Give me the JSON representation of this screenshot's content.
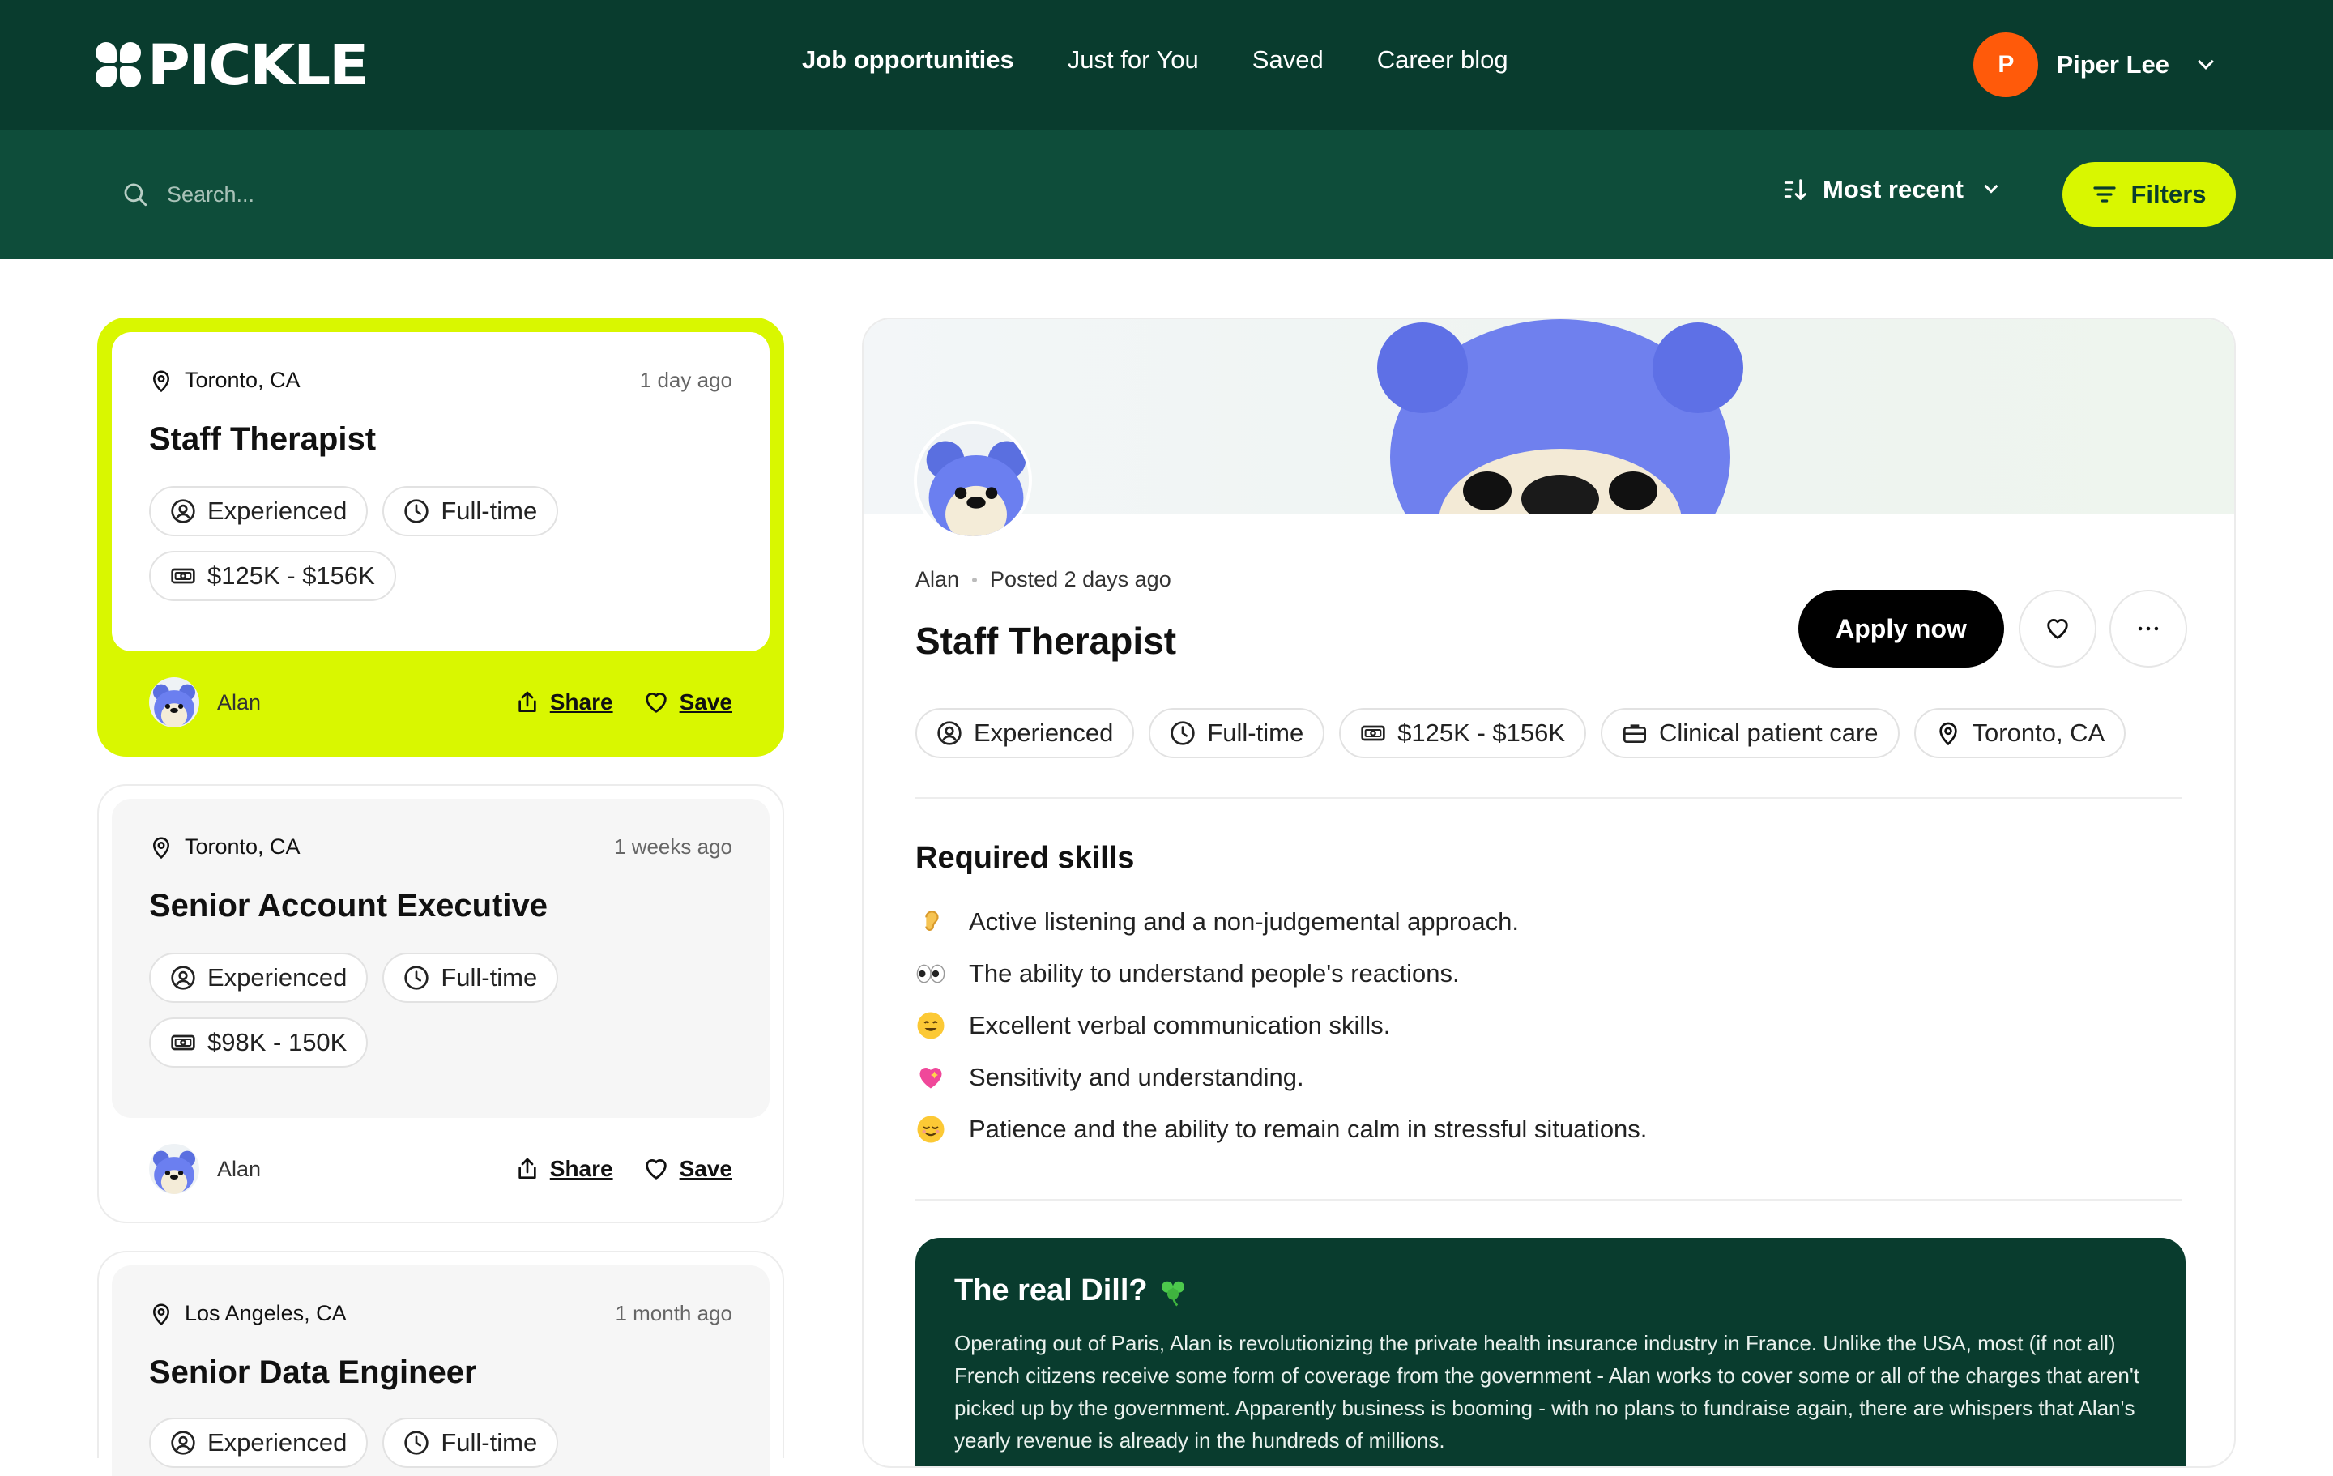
{
  "brand": {
    "name": "PICKLE"
  },
  "nav": {
    "items": [
      {
        "label": "Job opportunities",
        "active": true
      },
      {
        "label": "Just for You",
        "active": false
      },
      {
        "label": "Saved",
        "active": false
      },
      {
        "label": "Career blog",
        "active": false
      }
    ]
  },
  "user": {
    "initial": "P",
    "name": "Piper Lee",
    "avatar_color": "#ff5a0a"
  },
  "search": {
    "placeholder": "Search..."
  },
  "sort": {
    "label": "Most recent"
  },
  "filters": {
    "label": "Filters"
  },
  "colors": {
    "nav_bg": "#093c2e",
    "search_bg": "#0e4d3a",
    "accent": "#d9f700"
  },
  "jobs": [
    {
      "location": "Toronto, CA",
      "posted": "1 day ago",
      "title": "Staff Therapist",
      "level": "Experienced",
      "type": "Full-time",
      "salary": "$125K - $156K",
      "company": "Alan",
      "share": "Share",
      "save": "Save",
      "selected": true
    },
    {
      "location": "Toronto, CA",
      "posted": "1 weeks ago",
      "title": "Senior Account Executive",
      "level": "Experienced",
      "type": "Full-time",
      "salary": "$98K - 150K",
      "company": "Alan",
      "share": "Share",
      "save": "Save",
      "selected": false
    },
    {
      "location": "Los Angeles, CA",
      "posted": "1 month ago",
      "title": "Senior Data Engineer",
      "level": "Experienced",
      "type": "Full-time",
      "selected": false
    }
  ],
  "detail": {
    "company": "Alan",
    "posted": "Posted 2 days ago",
    "title": "Staff Therapist",
    "apply_label": "Apply now",
    "chips": {
      "level": "Experienced",
      "type": "Full-time",
      "salary": "$125K - $156K",
      "category": "Clinical patient care",
      "location": "Toronto, CA"
    },
    "skills_title": "Required skills",
    "skills": [
      {
        "icon": "ear-emoji",
        "text": "Active listening and a non-judgemental approach."
      },
      {
        "icon": "eyes-emoji",
        "text": "The ability to understand people's reactions."
      },
      {
        "icon": "smile-emoji",
        "text": "Excellent verbal communication skills."
      },
      {
        "icon": "heart-emoji",
        "text": "Sensitivity and understanding."
      },
      {
        "icon": "relieved-emoji",
        "text": "Patience and the ability to remain calm in stressful situations."
      }
    ],
    "dill_title": "The real Dill?",
    "dill_body": "Operating out of Paris, Alan is revolutionizing the private health insurance industry in France. Unlike the USA, most (if not all) French citizens receive some form of coverage from the government - Alan works to cover some or all of the charges that aren't picked up by the government. Apparently business is booming - with no plans to fundraise again, there are whispers that Alan's yearly revenue is already in the hundreds of millions."
  }
}
